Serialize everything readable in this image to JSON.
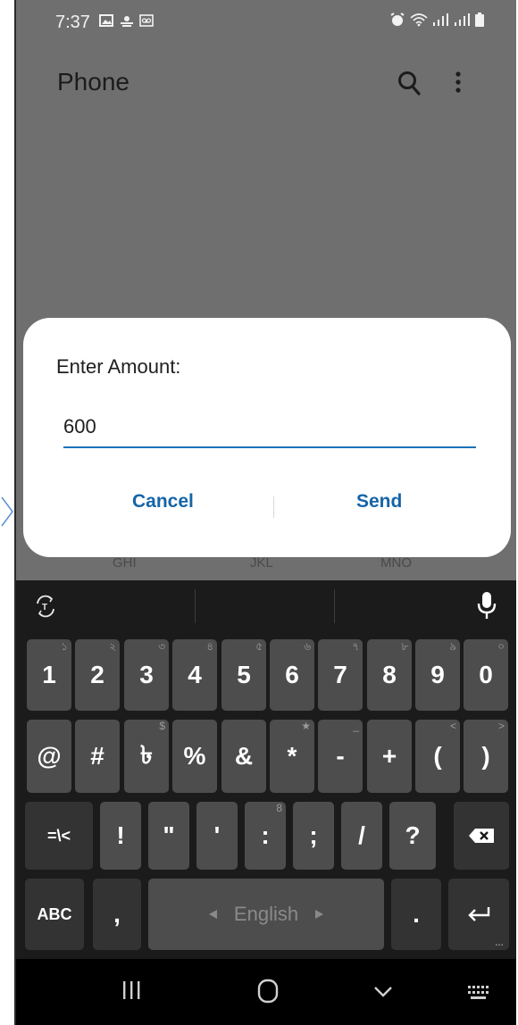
{
  "status_bar": {
    "time": "7:37"
  },
  "app_bar": {
    "title": "Phone"
  },
  "dialog": {
    "title": "Enter Amount:",
    "amount_value": "600",
    "cancel_label": "Cancel",
    "send_label": "Send",
    "accent_color": "#1565a8"
  },
  "dialpad_hint": {
    "ghi": "GHI",
    "jkl": "JKL",
    "mno": "MNO"
  },
  "keyboard": {
    "row1": [
      {
        "main": "1",
        "sub": "১"
      },
      {
        "main": "2",
        "sub": "২"
      },
      {
        "main": "3",
        "sub": "৩"
      },
      {
        "main": "4",
        "sub": "৪"
      },
      {
        "main": "5",
        "sub": "৫"
      },
      {
        "main": "6",
        "sub": "৬"
      },
      {
        "main": "7",
        "sub": "৭"
      },
      {
        "main": "8",
        "sub": "৮"
      },
      {
        "main": "9",
        "sub": "৯"
      },
      {
        "main": "0",
        "sub": "০"
      }
    ],
    "row2": [
      {
        "main": "@",
        "sub": ""
      },
      {
        "main": "#",
        "sub": ""
      },
      {
        "main": "৳",
        "sub": "$"
      },
      {
        "main": "%",
        "sub": ""
      },
      {
        "main": "&",
        "sub": ""
      },
      {
        "main": "*",
        "sub": "★"
      },
      {
        "main": "-",
        "sub": "_"
      },
      {
        "main": "+",
        "sub": ""
      },
      {
        "main": "(",
        "sub": "<"
      },
      {
        "main": ")",
        "sub": ">"
      }
    ],
    "row3": [
      {
        "main": "=\\<",
        "sub": ""
      },
      {
        "main": "!",
        "sub": ""
      },
      {
        "main": "\"",
        "sub": ""
      },
      {
        "main": "'",
        "sub": ""
      },
      {
        "main": ":",
        "sub": "8"
      },
      {
        "main": ";",
        "sub": ""
      },
      {
        "main": "/",
        "sub": ""
      },
      {
        "main": "?",
        "sub": ""
      }
    ],
    "abc_label": "ABC",
    "comma_label": ",",
    "space_label": "English",
    "period_label": "."
  },
  "icons": {
    "search": "search-icon",
    "more": "more-vert-icon",
    "translate": "translate-icon",
    "mic": "mic-icon",
    "backspace": "backspace-icon",
    "enter": "enter-icon",
    "recents": "recents-icon",
    "home": "home-icon",
    "back": "back-icon",
    "keyboard": "keyboard-icon"
  }
}
